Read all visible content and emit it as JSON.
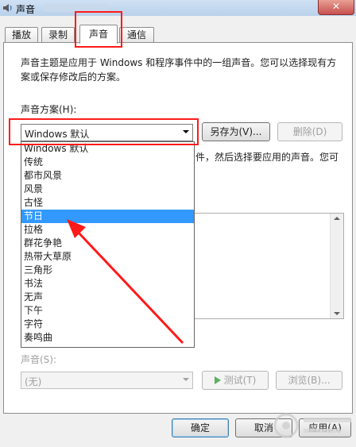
{
  "window": {
    "title": "声音"
  },
  "tabs": [
    {
      "label": "播放"
    },
    {
      "label": "录制"
    },
    {
      "label": "声音"
    },
    {
      "label": "通信"
    }
  ],
  "sound_tab": {
    "description": "声音主题是应用于 Windows 和程序事件中的一组声音。您可以选择现有方案或保存修改后的方案。",
    "scheme_label": "声音方案(H):",
    "scheme_selected": "Windows 默认",
    "save_as_label": "另存为(V)...",
    "delete_label": "删除(D)",
    "hidden_text_fragment": "件，然后选择要应用的声音。您可",
    "sound_label": "声音(S):",
    "sound_value": "(无)",
    "test_label": "测试(T)",
    "browse_label": "浏览(B)..."
  },
  "scheme_options": [
    "Windows 默认",
    "传统",
    "都市风景",
    "风景",
    "古怪",
    "节日",
    "拉格",
    "群花争艳",
    "热带大草原",
    "三角形",
    "书法",
    "无声",
    "下午",
    "字符",
    "奏鸣曲"
  ],
  "highlighted_option_index": 5,
  "dialog_buttons": {
    "ok": "确定",
    "cancel": "取消",
    "apply": "应用(A)"
  },
  "colors": {
    "selection": "#3399ff",
    "annotation_red": "#ff1a1a"
  }
}
